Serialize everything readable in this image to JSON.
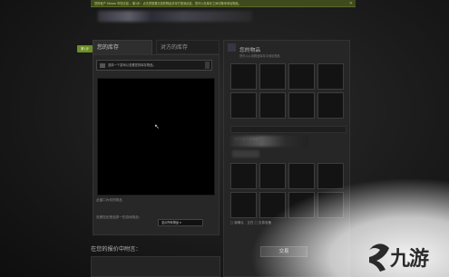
{
  "banner": {
    "text": "您的帐户 Steam 市场交易... 第1步：点击您想要交易的物品并将它拖到此处。您可以在库存之间切换来添加物品。",
    "close": "✕"
  },
  "left": {
    "step_badge": "第1步",
    "tab_mine": "您的库存",
    "tab_theirs": "对方的库存",
    "dropdown_text": "选择一个游戏以查看您的库存物品。",
    "inventory_note": "此窗口为你的物品",
    "filter_note": "查看您还是选择一些游戏物品：",
    "filter_button": "显示所有物品 ▾"
  },
  "message": {
    "title": "在您的报价中附言："
  },
  "right": {
    "title": "您的物品",
    "subtitle": "您可以从该物品库存中添加物品",
    "status": "您将交易 0 件物品",
    "confirm_line": "◻ 我确认 · 正在 ◻ 交易准备"
  },
  "trade_button": "交易",
  "watermark": {
    "logo_text": "九游"
  },
  "colors": {
    "banner_bg": "#3f4a1f",
    "badge": "#6b8e23",
    "panel": "#262626",
    "slot": "#131313"
  }
}
